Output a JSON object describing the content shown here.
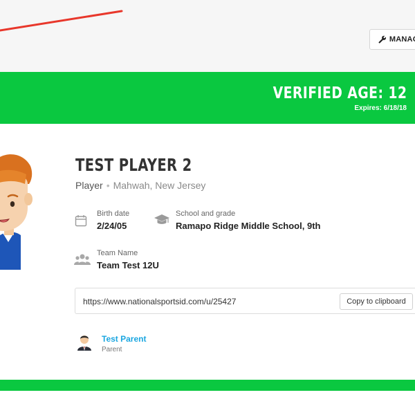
{
  "header": {
    "manage_label": "MANAGE"
  },
  "banner": {
    "verified_age": "VERIFIED AGE: 12",
    "expires": "Expires: 6/18/18"
  },
  "player": {
    "name": "TEST PLAYER 2",
    "role": "Player",
    "location": "Mahwah, New Jersey",
    "birth_label": "Birth date",
    "birth_value": "2/24/05",
    "school_label": "School and grade",
    "school_value": "Ramapo Ridge Middle School, 9th",
    "team_label": "Team Name",
    "team_value": "Team Test 12U"
  },
  "share": {
    "url": "https://www.nationalsportsid.com/u/25427",
    "copy_label": "Copy to clipboard"
  },
  "parent": {
    "name": "Test Parent",
    "role": "Parent"
  },
  "colors": {
    "green": "#0ac840",
    "link": "#1aa6e0",
    "annotation": "#e8372b"
  },
  "icons": {
    "manage": "wrench-icon",
    "birth": "calendar-icon",
    "school": "graduation-cap-icon",
    "team": "group-icon"
  }
}
